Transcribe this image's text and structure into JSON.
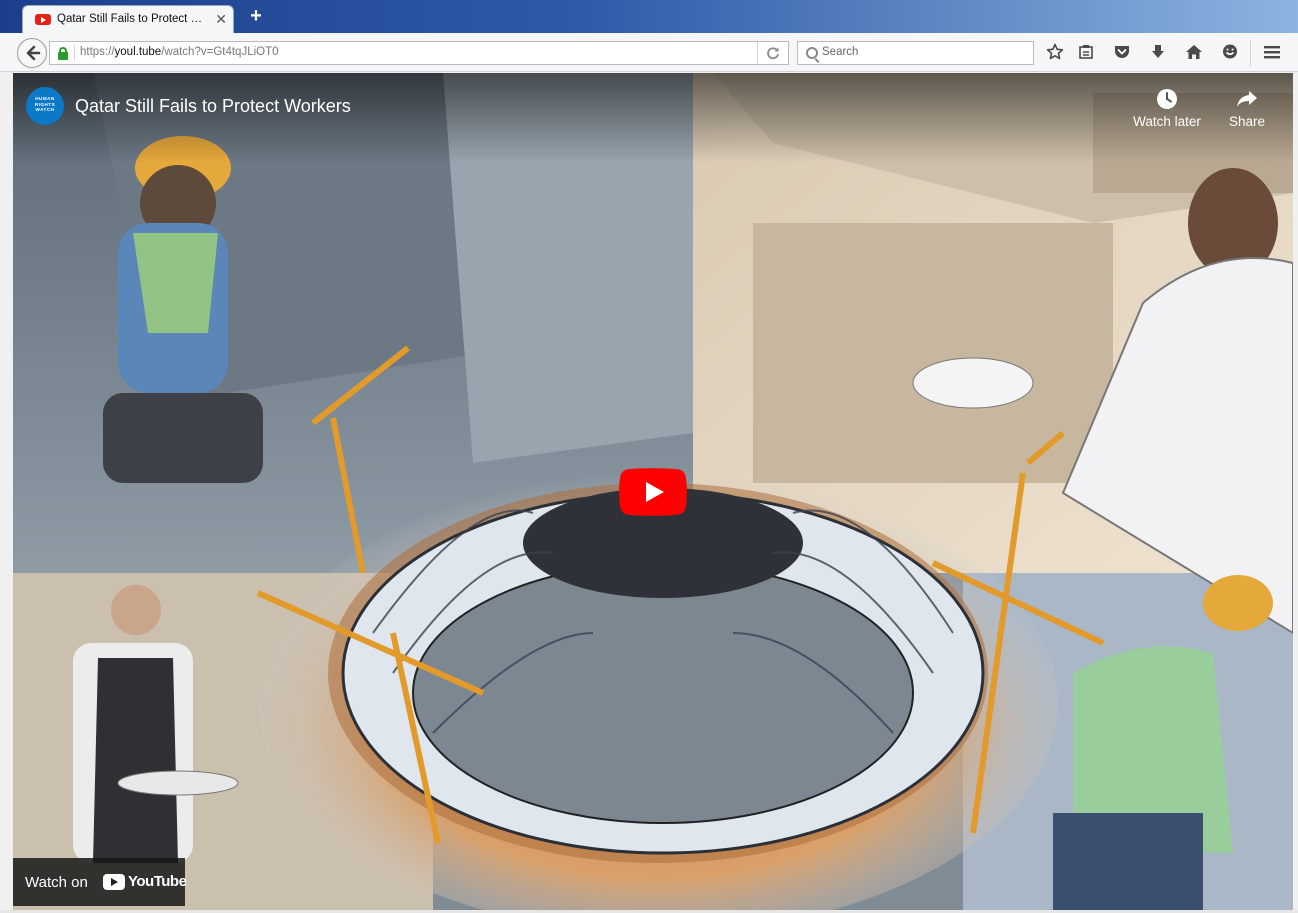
{
  "browser": {
    "tab": {
      "title": "Qatar Still Fails to Protect Wo...",
      "favicon": "youtube-favicon-icon"
    },
    "new_tab_symbol": "+",
    "url": {
      "prefix": "https://",
      "host": "youl.tube",
      "path": "/watch?v=Gt4tqJLiOT0"
    },
    "search_placeholder": "Search",
    "toolbar_icons": [
      "back-icon",
      "lock-icon",
      "reload-icon",
      "search-icon",
      "bookmark-star-icon",
      "reading-list-icon",
      "pocket-icon",
      "download-icon",
      "home-icon",
      "chat-icon",
      "menu-icon"
    ]
  },
  "video": {
    "channel_logo_text": [
      "HUMAN",
      "RIGHTS",
      "WATCH"
    ],
    "title": "Qatar Still Fails to Protect Workers",
    "actions": [
      {
        "label": "Watch later",
        "icon": "clock-icon"
      },
      {
        "label": "Share",
        "icon": "share-arrow-icon"
      }
    ],
    "watch_on": {
      "label": "Watch on",
      "brand": "YouTube"
    },
    "colors": {
      "play_red": "#ff0000",
      "logo_blue": "#0b78c8"
    }
  }
}
